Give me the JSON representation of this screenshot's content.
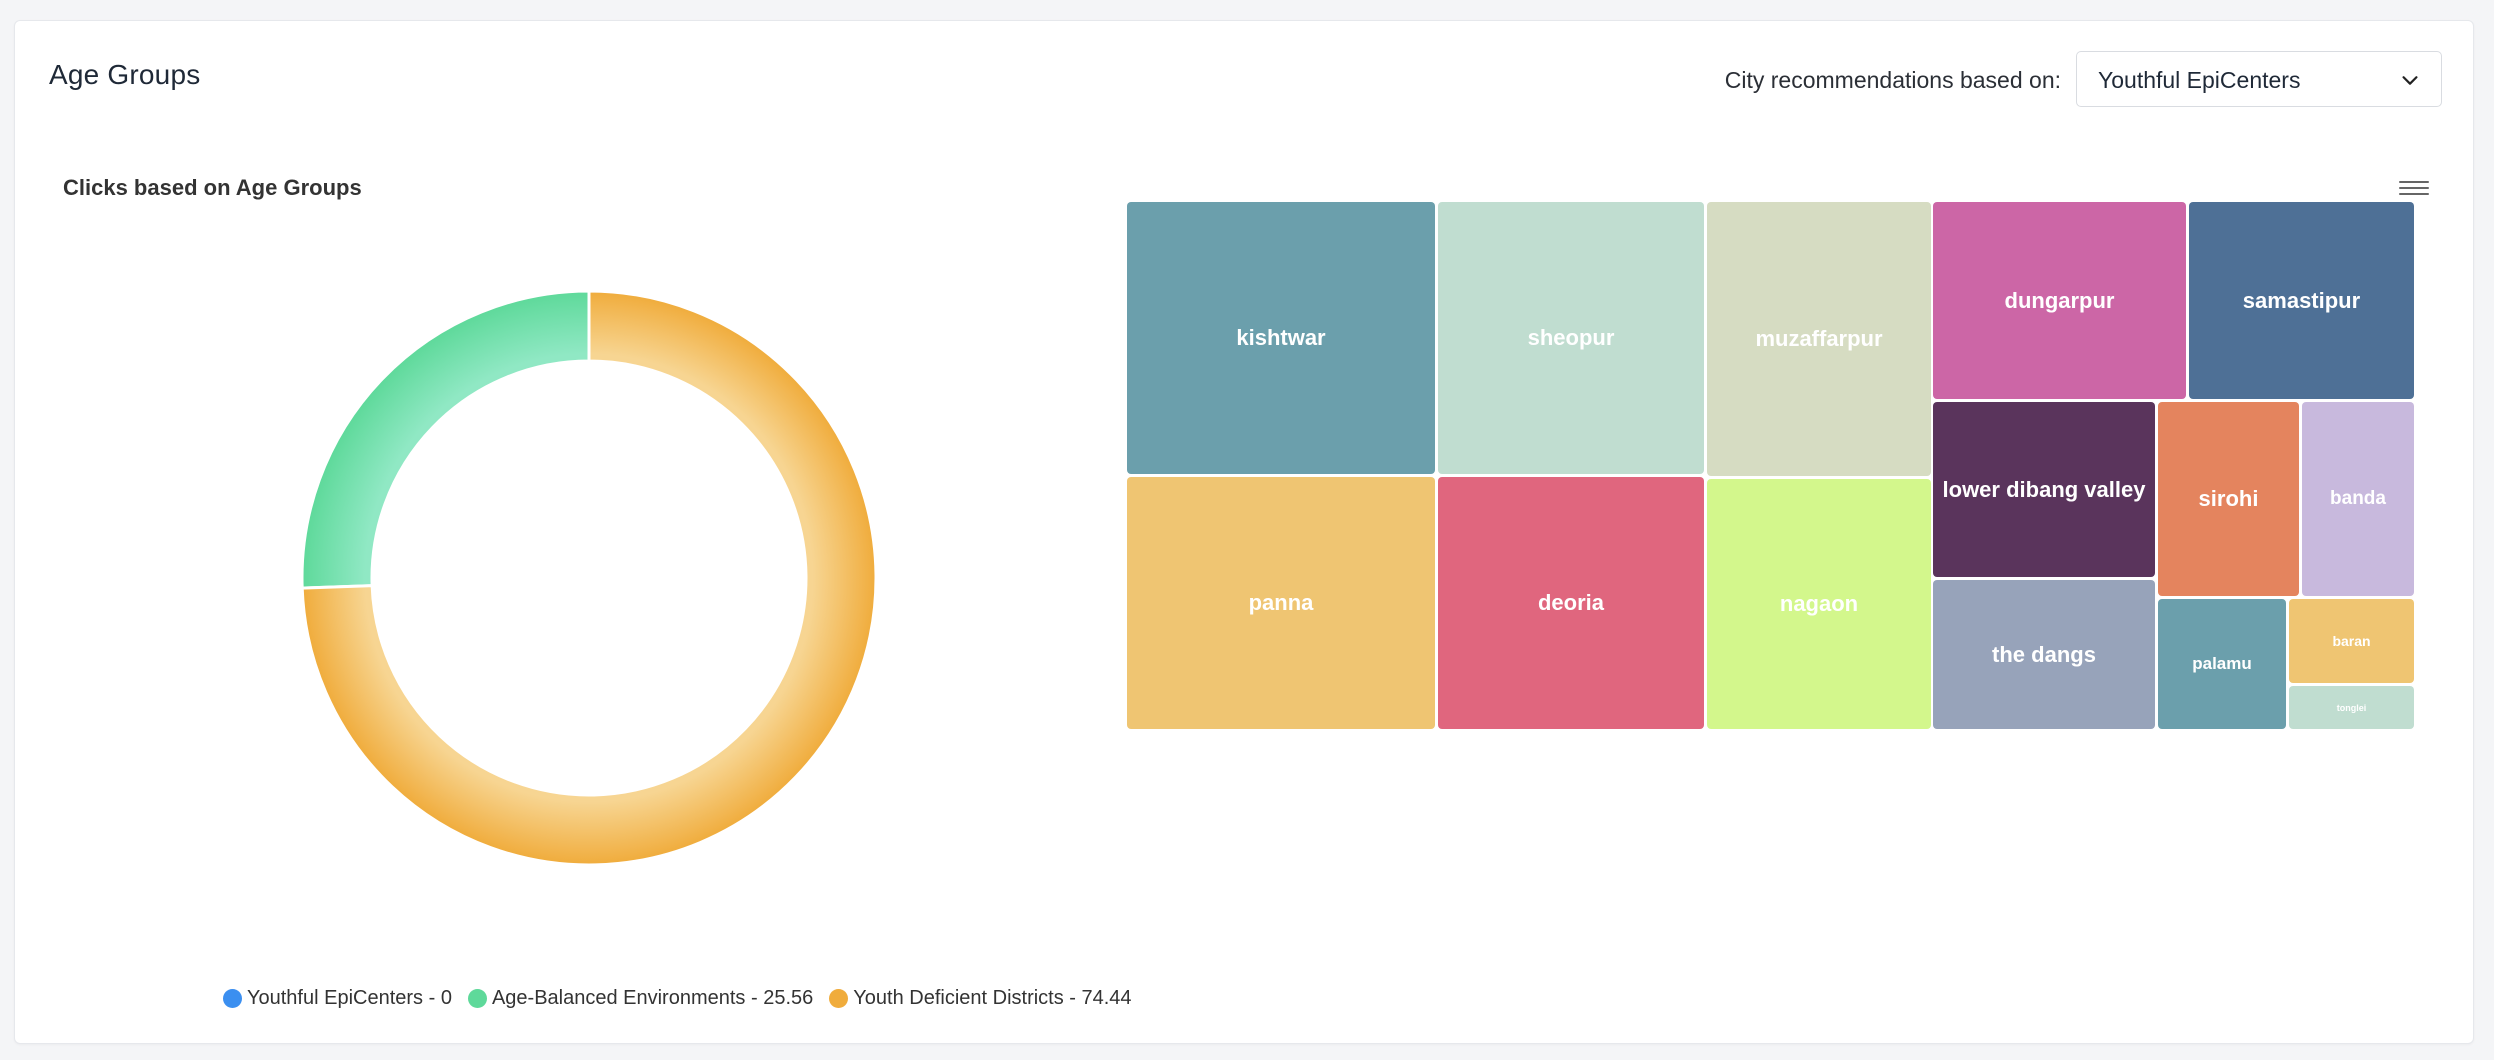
{
  "header": {
    "title": "Age Groups",
    "recommendation_label": "City recommendations based on:",
    "dropdown_value": "Youthful EpiCenters"
  },
  "donut": {
    "title": "Clicks based on Age Groups",
    "legend": [
      {
        "label": "Youthful EpiCenters - 0",
        "color": "#3b8ff0"
      },
      {
        "label": "Age-Balanced Environments - 25.56",
        "color": "#5ed99a"
      },
      {
        "label": "Youth Deficient Districts - 74.44",
        "color": "#f0ac3c"
      }
    ]
  },
  "chart_data": [
    {
      "type": "pie",
      "title": "Clicks based on Age Groups",
      "categories": [
        "Youthful EpiCenters",
        "Age-Balanced Environments",
        "Youth Deficient Districts"
      ],
      "values": [
        0,
        25.56,
        74.44
      ],
      "colors": [
        "#3b8ff0",
        "#5ed99a",
        "#f0ac3c"
      ],
      "legend_placement": "bottom",
      "donut": true
    },
    {
      "type": "treemap",
      "title": "",
      "categories": [
        "kishtwar",
        "sheopur",
        "muzaffarpur",
        "dungarpur",
        "samastipur",
        "panna",
        "deoria",
        "nagaon",
        "lower dibang valley",
        "sirohi",
        "banda",
        "the dangs",
        "palamu",
        "baran",
        "tonglei"
      ],
      "colors": [
        "#6b9fac",
        "#c0ddd0",
        "#d6dcc2",
        "#cc66a6",
        "#4e7096",
        "#efc572",
        "#e0667e",
        "#d3f78c",
        "#5a345c",
        "#e4845e",
        "#c8b9dd",
        "#97a3ba",
        "#6b9fac",
        "#efc572",
        "#c0ddd0"
      ]
    }
  ],
  "treemap_labels": {
    "kishtwar": "kishtwar",
    "sheopur": "sheopur",
    "muzaffarpur": "muzaffarpur",
    "dungarpur": "dungarpur",
    "samastipur": "samastipur",
    "panna": "panna",
    "deoria": "deoria",
    "nagaon": "nagaon",
    "lower_dibang_valley": "lower dibang valley",
    "sirohi": "sirohi",
    "banda": "banda",
    "the_dangs": "the dangs",
    "palamu": "palamu",
    "baran": "baran",
    "tonglei": "tonglei"
  },
  "icons": {
    "dropdown": "chevron-down-icon",
    "chart_menu": "hamburger-menu-icon"
  }
}
